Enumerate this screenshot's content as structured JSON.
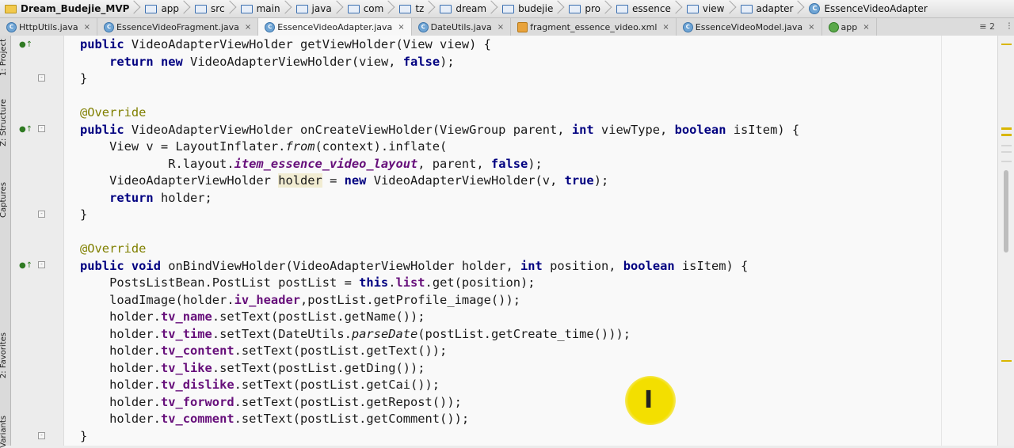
{
  "breadcrumb": [
    {
      "label": "Dream_Budejie_MVP",
      "icon": "project-folder-icon"
    },
    {
      "label": "app",
      "icon": "folder-icon"
    },
    {
      "label": "src",
      "icon": "folder-icon"
    },
    {
      "label": "main",
      "icon": "folder-icon"
    },
    {
      "label": "java",
      "icon": "folder-icon"
    },
    {
      "label": "com",
      "icon": "folder-icon"
    },
    {
      "label": "tz",
      "icon": "folder-icon"
    },
    {
      "label": "dream",
      "icon": "folder-icon"
    },
    {
      "label": "budejie",
      "icon": "folder-icon"
    },
    {
      "label": "pro",
      "icon": "folder-icon"
    },
    {
      "label": "essence",
      "icon": "folder-icon"
    },
    {
      "label": "view",
      "icon": "folder-icon"
    },
    {
      "label": "adapter",
      "icon": "folder-icon"
    },
    {
      "label": "EssenceVideoAdapter",
      "icon": "class-icon"
    }
  ],
  "tabs": [
    {
      "label": "HttpUtils.java",
      "icon": "class-icon",
      "active": false
    },
    {
      "label": "EssenceVideoFragment.java",
      "icon": "class-icon",
      "active": false
    },
    {
      "label": "EssenceVideoAdapter.java",
      "icon": "class-icon",
      "active": true
    },
    {
      "label": "DateUtils.java",
      "icon": "class-icon",
      "active": false
    },
    {
      "label": "fragment_essence_video.xml",
      "icon": "xml-file-icon",
      "active": false
    },
    {
      "label": "EssenceVideoModel.java",
      "icon": "class-icon",
      "active": false
    },
    {
      "label": "app",
      "icon": "android-module-icon",
      "active": false
    }
  ],
  "tab_close_glyph": "×",
  "tab_overflow": "≡ 2",
  "side_tabs": {
    "project": "1: Project",
    "structure": "Z: Structure",
    "captures": "Captures",
    "favorites": "2: Favorites",
    "variants": "Variants"
  },
  "code_lines": [
    "public VideoAdapterViewHolder getViewHolder(View view) {",
    "    return new VideoAdapterViewHolder(view, false);",
    "}",
    "",
    "@Override",
    "public VideoAdapterViewHolder onCreateViewHolder(ViewGroup parent, int viewType, boolean isItem) {",
    "    View v = LayoutInflater.from(context).inflate(",
    "            R.layout.item_essence_video_layout, parent, false);",
    "    VideoAdapterViewHolder holder = new VideoAdapterViewHolder(v, true);",
    "    return holder;",
    "}",
    "",
    "@Override",
    "public void onBindViewHolder(VideoAdapterViewHolder holder, int position, boolean isItem) {",
    "    PostsListBean.PostList postList = this.list.get(position);",
    "    loadImage(holder.iv_header,postList.getProfile_image());",
    "    holder.tv_name.setText(postList.getName());",
    "    holder.tv_time.setText(DateUtils.parseDate(postList.getCreate_time()));",
    "    holder.tv_content.setText(postList.getText());",
    "    holder.tv_like.setText(postList.getDing());",
    "    holder.tv_dislike.setText(postList.getCai());",
    "    holder.tv_forword.setText(postList.getRepost());",
    "    holder.tv_comment.setText(postList.getComment());",
    "}"
  ],
  "gutter_icon": "override-marker-icon",
  "cursor_icon": "text-cursor-icon",
  "colors": {
    "keyword": "#000080",
    "annotation": "#808000",
    "field": "#660e7a",
    "highlight": "#f1ecd2",
    "cursor_halo": "#f3df00"
  }
}
